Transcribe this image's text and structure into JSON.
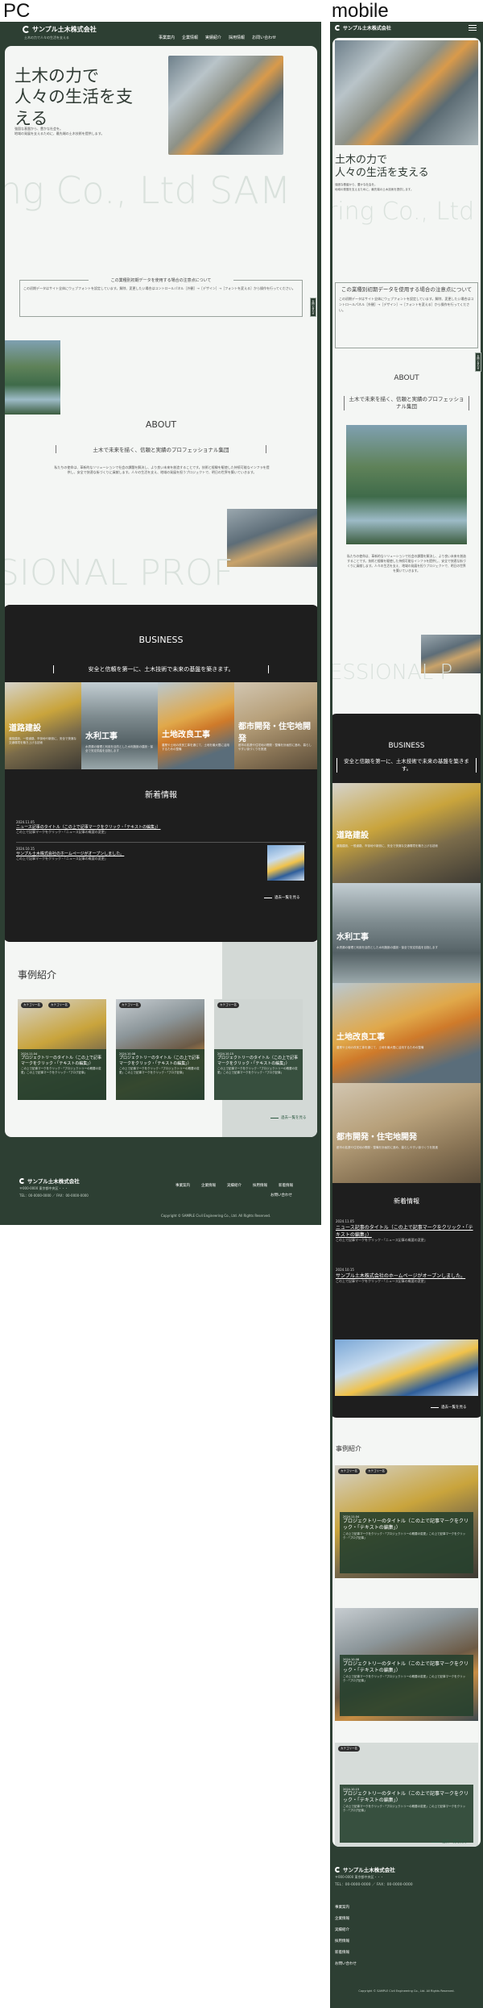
{
  "labels": {
    "pc": "PC",
    "mobile": "mobile"
  },
  "company": {
    "name": "サンプル土木株式会社",
    "sub": "土木の力で人々の生活を支える",
    "zip": "〒000-0000 東京都中央区・・・",
    "tel": "TEL：00-0000-0000 ／ FAX：00-0000-0000",
    "copyright": "Copyright © SAMPLE Civil Engineering Co., Ltd. All Rights Reserved."
  },
  "nav": [
    "事業案内",
    "企業情報",
    "実績紹介",
    "採用情報",
    "お問い合わせ"
  ],
  "footer_nav": [
    "事業案内",
    "企業情報",
    "実績紹介",
    "採用情報",
    "新着情報",
    "お問い合わせ"
  ],
  "hero": {
    "title_pc": "土木の力で\n人々の生活を支\nえる",
    "title_mb": "土木の力で\n人々の生活を支える",
    "desc": "強固な基盤から、豊かな社会を。\n地域の発展を支えるために、最先端の土木技術を提供します。",
    "bg_text_pc": "ng Co., Ltd SAM",
    "bg_text_mb": "ring Co., Ltd"
  },
  "notice": {
    "title": "この業種別初期データを使用する場合の注意点について",
    "body": "この初期データはサイト全体にウェブフォントを設定しています。解除、変更したい場合はコントロールパネル［外観］→［デザイン］→［フォントを変える］から操作を行ってください。"
  },
  "about": {
    "title": "ABOUT",
    "catch": "土木で未来を描く、信頼と実績のプロフェッショナル集団",
    "body": "私たちの使命は、革新的なソリューションで社会の課題を解決し、より良い未来を創造することです。技術と経験を駆使した持続可能なインフラを提供し、安全で快適な街づくりに貢献します。人々の生活を支え、地域の発展を担うプロジェクトで、明日の世界を築いていきます。",
    "bg_text": "SIONAL PROF",
    "bg_text_mb": "ESSIONAL P"
  },
  "business": {
    "title": "BUSINESS",
    "catch": "安全と信頼を第一に、土木技術で未来の基盤を築きます。",
    "items": [
      {
        "name": "道路建設",
        "desc": "道路建設、一般道路、市街地や新設に、安全で快適な交通環境を築き上げる技術"
      },
      {
        "name": "水利工事",
        "desc": "水資源の管理と利用を目的とした水利施設の建設・保全で安定供給を目指します"
      },
      {
        "name": "土地改良工事",
        "desc": "農業や土地の改良工事を通じて、土地を最大限に活用するための整備"
      },
      {
        "name": "都市開発・住宅地開発",
        "desc": "都市の拡張や住宅地の開発・整備を計画的に進め、暮らしやすい街づくりを推進"
      }
    ]
  },
  "news": {
    "title": "新着情報",
    "items": [
      {
        "date": "2024.11.05",
        "title": "ニュース記事のタイトル（この上で記事マークをクリック・「テキストの編集」）",
        "desc": "この上で記事マークをクリック・「ニュース記事の概要の変更」"
      },
      {
        "date": "2024.10.15",
        "title": "サンプル土木株式会社のホームページがオープンしました。",
        "desc": "この上で記事マークをクリック・「ニュース記事の概要の変更」"
      }
    ],
    "more": "過去一覧を見る"
  },
  "cases": {
    "title": "事例紹介",
    "tag": "カテゴリー名",
    "items": [
      {
        "date": "2024.11.04",
        "title": "プロジェクトリーのタイトル（この上で記事マークをクリック・「テキストの編集」）",
        "desc": "この上で記事マークをクリック・「プロジェクトリーの概要の変更」この上で記事マークをクリック・「ブログ記事」"
      },
      {
        "date": "2024.10.08",
        "title": "プロジェクトリーのタイトル（この上で記事マークをクリック・「テキストの編集」）",
        "desc": "この上で記事マークをクリック・「プロジェクトリーの概要の変更」この上で記事マークをクリック・「ブログ記事」"
      },
      {
        "date": "2024.10.15",
        "title": "プロジェクトリーのタイトル（この上で記事マークをクリック・「テキストの編集」）",
        "desc": "この上で記事マークをクリック・「プロジェクトリーの概要の変更」この上で記事マークをクリック・「ブログ記事」"
      }
    ],
    "more": "過去一覧を見る"
  },
  "vtab": "お問い合わせ"
}
